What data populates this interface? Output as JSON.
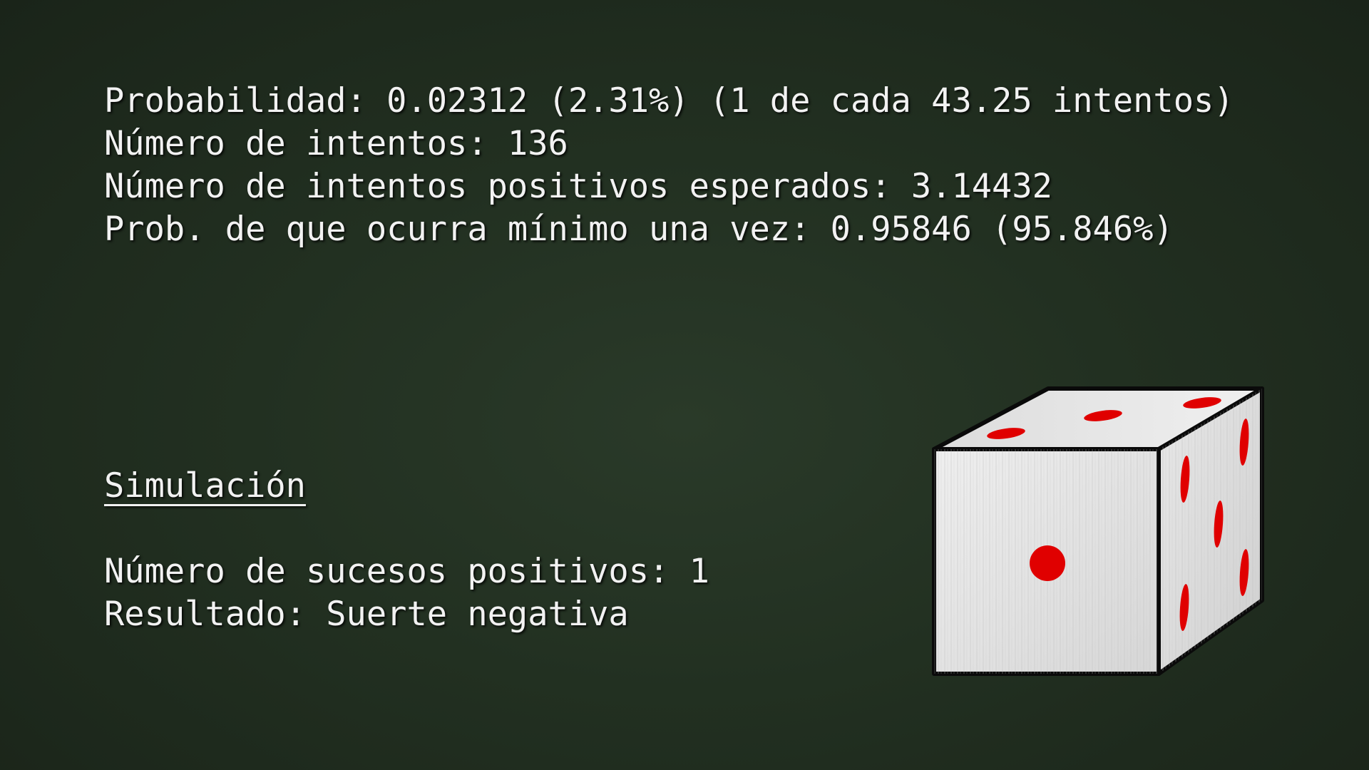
{
  "stats": {
    "probability": "Probabilidad: 0.02312 (2.31%) (1 de cada 43.25 intentos)",
    "attempts": "Número de intentos: 136",
    "expected_positive": "Número de intentos positivos esperados: 3.14432",
    "prob_at_least_once": "Prob. de que ocurra mínimo una vez: 0.95846 (95.846%)"
  },
  "simulation": {
    "title": "Simulación",
    "positive_events": "Número de sucesos positivos: 1",
    "result": "Resultado: Suerte negativa"
  },
  "dice": {
    "icon": "dice-icon",
    "front_face": 1,
    "top_face": 3,
    "right_face": 6,
    "face_color": "#e6e6e6",
    "pip_color": "#e00000",
    "outline_color": "#0a0a0a"
  },
  "colors": {
    "background": "#223021",
    "text": "#f2f2f2"
  }
}
